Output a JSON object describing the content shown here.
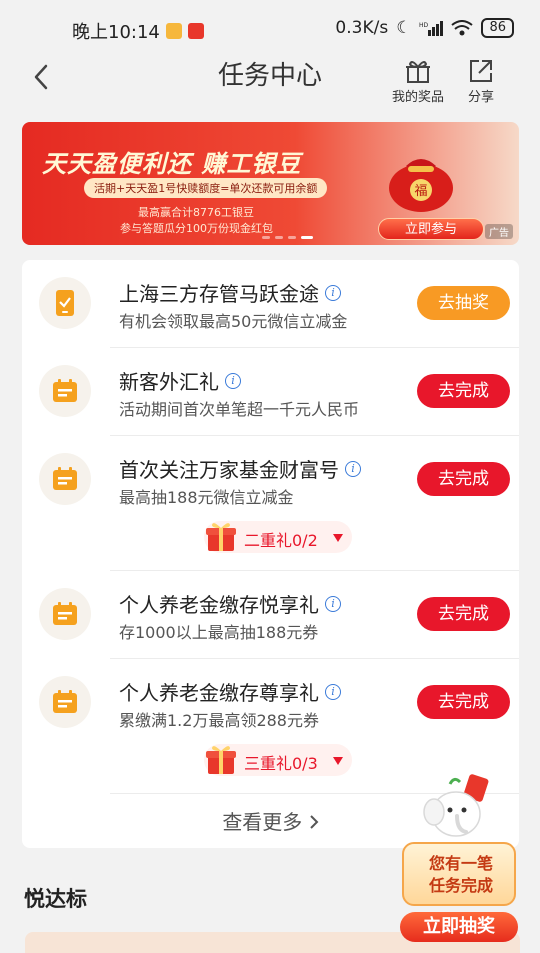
{
  "status_bar": {
    "time": "晚上10:14",
    "net_speed": "0.3K/s",
    "battery": "86"
  },
  "header": {
    "title": "任务中心",
    "prizes_label": "我的奖品",
    "share_label": "分享"
  },
  "banner": {
    "title": "天天盈便利还 赚工银豆",
    "subtitle": "活期+天天盈1号快赎额度=单次还款可用余额",
    "line1": "最高赢合计8776工银豆",
    "line2": "参与答题瓜分100万份现金红包",
    "cta": "立即参与",
    "ad_tag": "广告",
    "bag_char": "福"
  },
  "tasks": [
    {
      "title": "上海三方存管马跃金途",
      "desc": "有机会领取最高50元微信立减金",
      "button": "去抽奖",
      "icon": "phone-task-icon"
    },
    {
      "title": "新客外汇礼",
      "desc": "活动期间首次单笔超一千元人民币",
      "button": "去完成",
      "icon": "calendar-task-icon"
    },
    {
      "title": "首次关注万家基金财富号",
      "desc": "最高抽188元微信立减金",
      "button": "去完成",
      "icon": "calendar-task-icon",
      "gift": "二重礼0/2"
    },
    {
      "title": "个人养老金缴存悦享礼",
      "desc": "存1000以上最高抽188元券",
      "button": "去完成",
      "icon": "calendar-task-icon"
    },
    {
      "title": "个人养老金缴存尊享礼",
      "desc": "累缴满1.2万最高领288元券",
      "button": "去完成",
      "icon": "calendar-task-icon",
      "gift": "三重礼0/3"
    }
  ],
  "see_more": "查看更多",
  "section_title": "悦达标",
  "float_badge": {
    "line1": "您有一笔",
    "line2": "任务完成",
    "cta": "立即抽奖"
  },
  "colors": {
    "accent_red": "#e8172b",
    "accent_orange": "#f89a24",
    "icon_orange": "#f5a11e"
  }
}
